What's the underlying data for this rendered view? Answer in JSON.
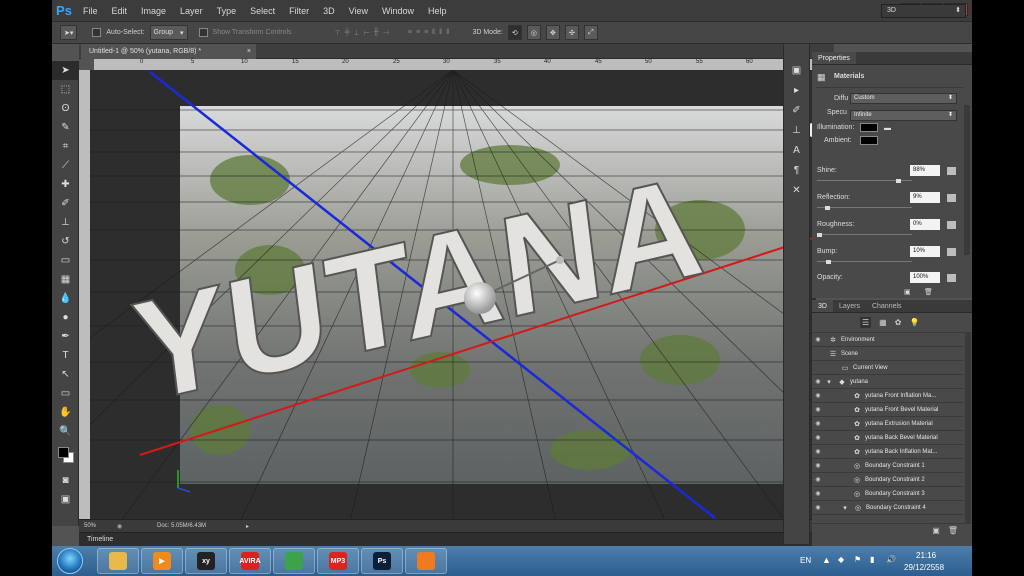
{
  "app": {
    "logo": "Ps"
  },
  "menu": [
    "File",
    "Edit",
    "Image",
    "Layer",
    "Type",
    "Select",
    "Filter",
    "3D",
    "View",
    "Window",
    "Help"
  ],
  "window_controls": [
    "–",
    "❐",
    "✕"
  ],
  "options": {
    "auto_select_label": "Auto-Select:",
    "auto_select_value": "Group",
    "show_transform": "Show Transform Controls",
    "mode_label": "3D Mode:",
    "workspace": "3D"
  },
  "document": {
    "tab": "Untitled-1 @ 50% (yutana, RGB/8) *",
    "close": "×"
  },
  "ruler": {
    "ticks": [
      "0",
      "5",
      "10",
      "15",
      "20",
      "25",
      "30",
      "35",
      "40",
      "45",
      "50",
      "55",
      "60"
    ]
  },
  "status": {
    "zoom": "50%",
    "doc": "Doc: 5.05M/6.43M"
  },
  "timeline": {
    "label": "Timeline"
  },
  "scene_text": "YUTANA",
  "properties": {
    "tab": "Properties",
    "title": "Materials",
    "diffuse_label": "Diffu",
    "diffuse_value": "Custom",
    "specular_label": "Specu",
    "specular_value": "Infinite",
    "illumination_label": "Illumination:",
    "ambient_label": "Ambient:",
    "shine_label": "Shine:",
    "shine_value": "88%",
    "shine": 0.88,
    "reflection_label": "Reflection:",
    "reflection_value": "9%",
    "reflection": 0.09,
    "roughness_label": "Roughness:",
    "roughness_value": "0%",
    "roughness": 0.0,
    "bump_label": "Bump:",
    "bump_value": "10%",
    "bump": 0.1,
    "opacity_label": "Opacity:",
    "opacity_value": "100%",
    "opacity": 1.0
  },
  "scene_panel": {
    "tabs": [
      "3D",
      "Layers",
      "Channels"
    ],
    "rows": [
      {
        "label": "Environment",
        "icon": "environment-icon"
      },
      {
        "label": "Scene",
        "icon": "scene-icon"
      },
      {
        "label": "Current View",
        "icon": "camera-icon"
      },
      {
        "label": "yutana",
        "icon": "mesh-icon"
      },
      {
        "label": "yutana Front Inflation Ma...",
        "icon": "material-icon"
      },
      {
        "label": "yutana Front Bevel Material",
        "icon": "material-icon"
      },
      {
        "label": "yutana Extrusion Material",
        "icon": "material-icon"
      },
      {
        "label": "yutana Back Bevel Material",
        "icon": "material-icon"
      },
      {
        "label": "yutana Back Inflation Mat...",
        "icon": "material-icon"
      },
      {
        "label": "Boundary Constraint 1",
        "icon": "constraint-icon"
      },
      {
        "label": "Boundary Constraint 2",
        "icon": "constraint-icon"
      },
      {
        "label": "Boundary Constraint 3",
        "icon": "constraint-icon"
      },
      {
        "label": "Boundary Constraint 4",
        "icon": "constraint-icon"
      }
    ]
  },
  "taskbar": {
    "apps": [
      {
        "name": "explorer",
        "color": "#e8b84a",
        "glyph": ""
      },
      {
        "name": "media-player",
        "color": "#f08a1a",
        "glyph": "▶"
      },
      {
        "name": "app-xy",
        "color": "#222222",
        "glyph": "xy"
      },
      {
        "name": "avira",
        "color": "#e02020",
        "glyph": "AVIRA"
      },
      {
        "name": "chrome",
        "color": "#3ca34a",
        "glyph": ""
      },
      {
        "name": "mp3",
        "color": "#d22",
        "glyph": "MP3"
      },
      {
        "name": "photoshop",
        "color": "#0b1f3a",
        "glyph": "Ps"
      },
      {
        "name": "app-orange",
        "color": "#f07a22",
        "glyph": ""
      }
    ],
    "lang": "EN",
    "time": "21:16",
    "date": "29/12/2558"
  }
}
